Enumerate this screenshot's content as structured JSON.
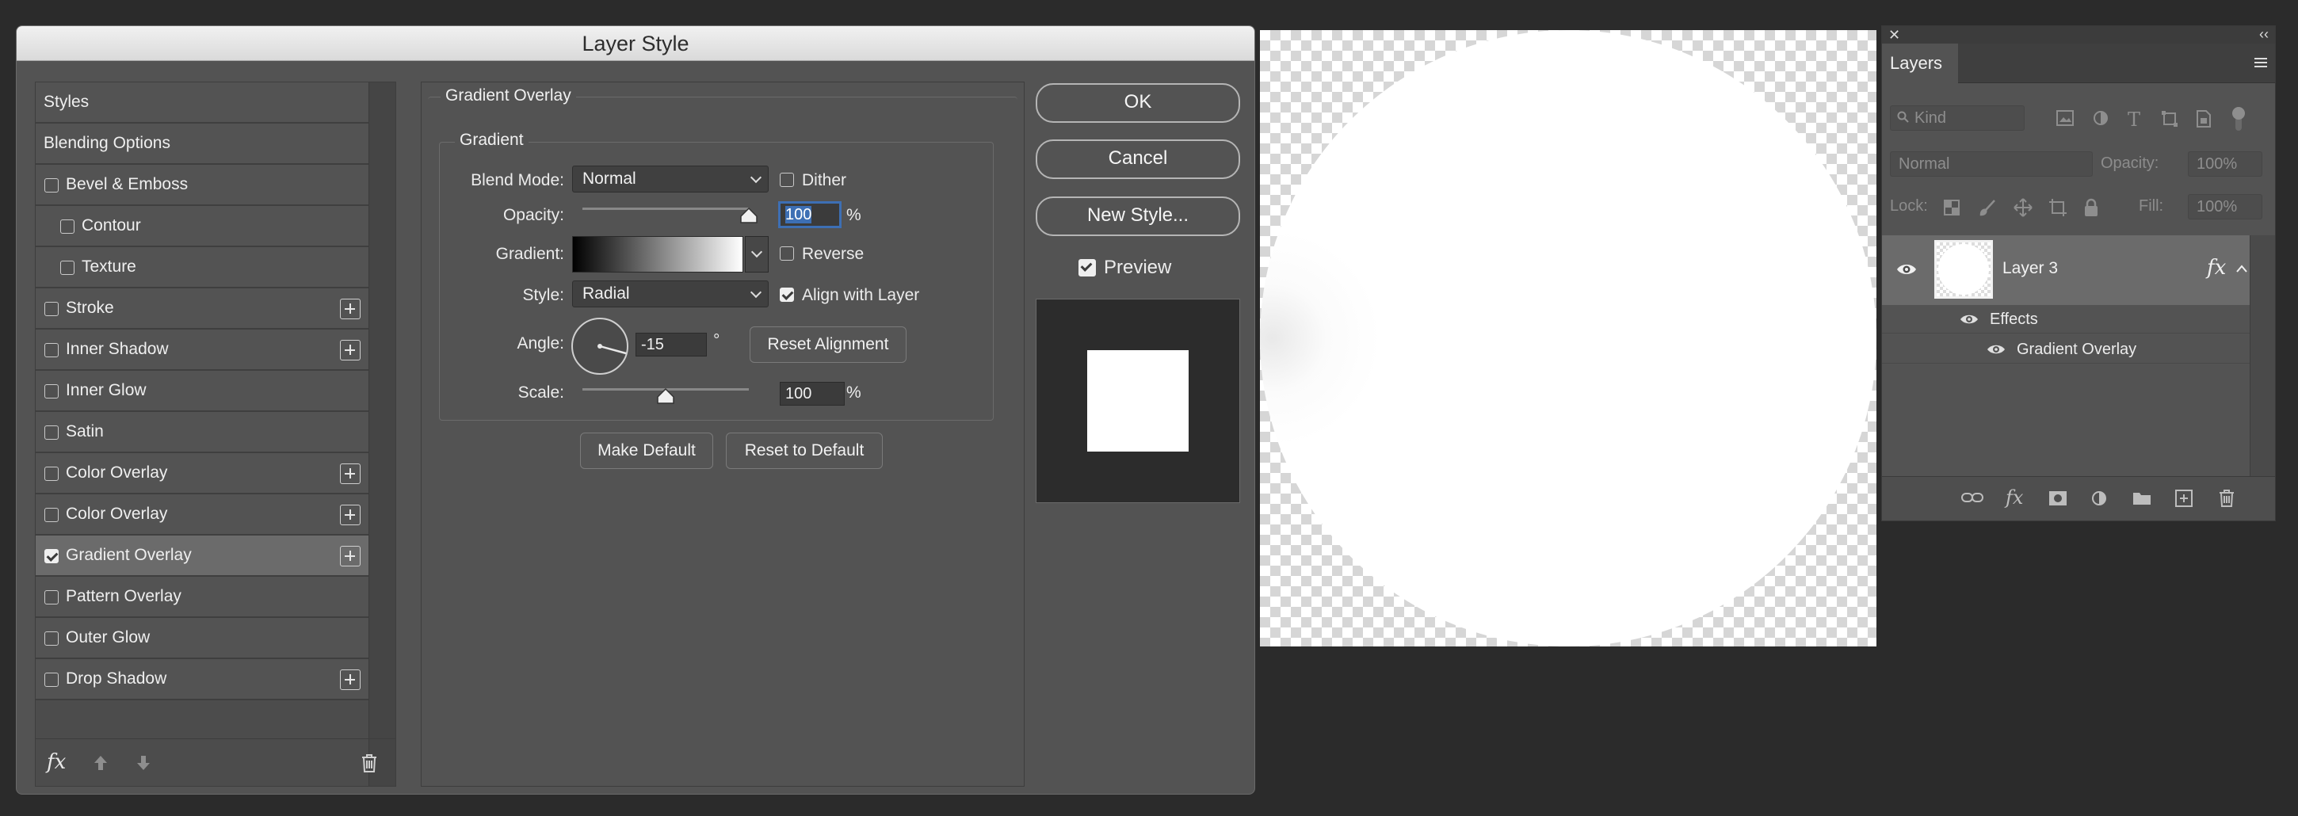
{
  "dialog": {
    "title": "Layer Style",
    "styles_list": [
      {
        "label": "Styles",
        "checkbox": false,
        "checked": false,
        "plus": false,
        "indent": 0,
        "selected": false
      },
      {
        "label": "Blending Options",
        "checkbox": false,
        "checked": false,
        "plus": false,
        "indent": 0,
        "selected": false
      },
      {
        "label": "Bevel & Emboss",
        "checkbox": true,
        "checked": false,
        "plus": false,
        "indent": 0,
        "selected": false
      },
      {
        "label": "Contour",
        "checkbox": true,
        "checked": false,
        "plus": false,
        "indent": 1,
        "selected": false
      },
      {
        "label": "Texture",
        "checkbox": true,
        "checked": false,
        "plus": false,
        "indent": 1,
        "selected": false
      },
      {
        "label": "Stroke",
        "checkbox": true,
        "checked": false,
        "plus": true,
        "indent": 0,
        "selected": false
      },
      {
        "label": "Inner Shadow",
        "checkbox": true,
        "checked": false,
        "plus": true,
        "indent": 0,
        "selected": false
      },
      {
        "label": "Inner Glow",
        "checkbox": true,
        "checked": false,
        "plus": false,
        "indent": 0,
        "selected": false
      },
      {
        "label": "Satin",
        "checkbox": true,
        "checked": false,
        "plus": false,
        "indent": 0,
        "selected": false
      },
      {
        "label": "Color Overlay",
        "checkbox": true,
        "checked": false,
        "plus": true,
        "indent": 0,
        "selected": false
      },
      {
        "label": "Color Overlay",
        "checkbox": true,
        "checked": false,
        "plus": true,
        "indent": 0,
        "selected": false
      },
      {
        "label": "Gradient Overlay",
        "checkbox": true,
        "checked": true,
        "plus": true,
        "indent": 0,
        "selected": true
      },
      {
        "label": "Pattern Overlay",
        "checkbox": true,
        "checked": false,
        "plus": false,
        "indent": 0,
        "selected": false
      },
      {
        "label": "Outer Glow",
        "checkbox": true,
        "checked": false,
        "plus": false,
        "indent": 0,
        "selected": false
      },
      {
        "label": "Drop Shadow",
        "checkbox": true,
        "checked": false,
        "plus": true,
        "indent": 0,
        "selected": false
      }
    ],
    "gradient_overlay": {
      "section_title": "Gradient Overlay",
      "group_title": "Gradient",
      "blend_mode_label": "Blend Mode:",
      "blend_mode_value": "Normal",
      "dither_label": "Dither",
      "dither_checked": false,
      "opacity_label": "Opacity:",
      "opacity_value": "100",
      "opacity_fraction": 1.0,
      "percent": "%",
      "gradient_label": "Gradient:",
      "reverse_label": "Reverse",
      "reverse_checked": false,
      "style_label": "Style:",
      "style_value": "Radial",
      "align_label": "Align with Layer",
      "align_checked": true,
      "angle_label": "Angle:",
      "angle_value": "-15",
      "degree": "°",
      "reset_alignment": "Reset Alignment",
      "scale_label": "Scale:",
      "scale_value": "100",
      "scale_fraction": 0.5,
      "make_default": "Make Default",
      "reset_to_default": "Reset to Default"
    },
    "buttons": {
      "ok": "OK",
      "cancel": "Cancel",
      "new_style": "New Style..."
    },
    "preview_label": "Preview",
    "preview_checked": true,
    "fx_label": "fx"
  },
  "layers_panel": {
    "tab": "Layers",
    "filter_kind": "Kind",
    "blend_mode": "Normal",
    "opacity_label": "Opacity:",
    "opacity_value": "100%",
    "lock_label": "Lock:",
    "fill_label": "Fill:",
    "fill_value": "100%",
    "layer_name": "Layer 3",
    "fx_badge": "fx",
    "effects_label": "Effects",
    "effect_item": "Gradient Overlay"
  },
  "colors": {
    "dialog_bg": "#535353",
    "selected_row": "#6b6b6b",
    "opacity_highlight": "#3d6fb4",
    "canvas_shape": "#ffffff"
  }
}
